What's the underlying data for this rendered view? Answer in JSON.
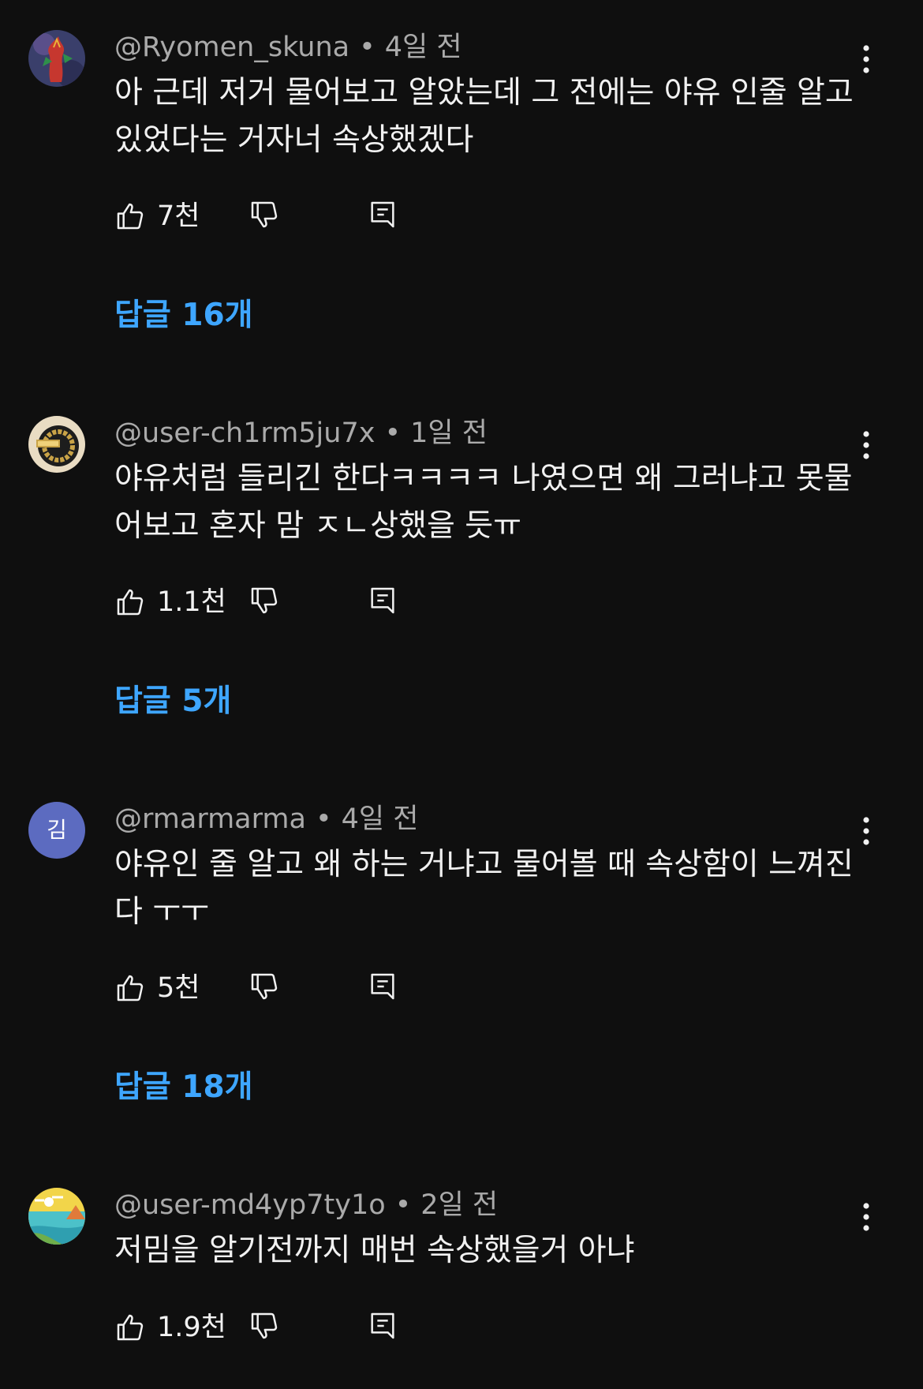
{
  "comments": [
    {
      "author": "@Ryomen_skuna",
      "separator": "•",
      "time": "4일 전",
      "avatar": {
        "kind": "image",
        "icon": "red-dragon-avatar"
      },
      "lines": [
        "아 근데 저거 물어보고 알았는데 그 전에는 야유 인줄 알고",
        "있었다는 거자너 속상했겠다"
      ],
      "likes": "7천",
      "replies": "답글 16개"
    },
    {
      "author": "@user-ch1rm5ju7x",
      "separator": "•",
      "time": "1일 전",
      "avatar": {
        "kind": "image",
        "icon": "gold-chain-avatar"
      },
      "lines": [
        "야유처럼 들리긴 한다ㅋㅋㅋㅋ 나였으면 왜 그러냐고 못물",
        "어보고 혼자 맘 ㅈㄴ상했을 듯ㅠ"
      ],
      "likes": "1.1천",
      "replies": "답글 5개"
    },
    {
      "author": "@rmarmarma",
      "separator": "•",
      "time": "4일 전",
      "avatar": {
        "kind": "letter",
        "letter": "김",
        "color": "#5c6bc0"
      },
      "lines": [
        "야유인 줄 알고 왜 하는 거냐고 물어볼 때 속상함이 느껴진",
        "다 ㅜㅜ"
      ],
      "likes": "5천",
      "replies": "답글 18개"
    },
    {
      "author": "@user-md4yp7ty1o",
      "separator": "•",
      "time": "2일 전",
      "avatar": {
        "kind": "image",
        "icon": "beach-landscape-avatar"
      },
      "lines": [
        "저밈을 알기전까지 매번 속상했을거 아냐"
      ],
      "likes": "1.9천",
      "replies": ""
    }
  ],
  "colors": {
    "background": "#0f0f0f",
    "text": "#f1f1f1",
    "secondary_text": "#aaaaaa",
    "link": "#3ea6ff"
  },
  "icons": {
    "like": "thumb-up-icon",
    "dislike": "thumb-down-icon",
    "reply": "reply-comment-icon",
    "more": "more-vertical-icon"
  }
}
